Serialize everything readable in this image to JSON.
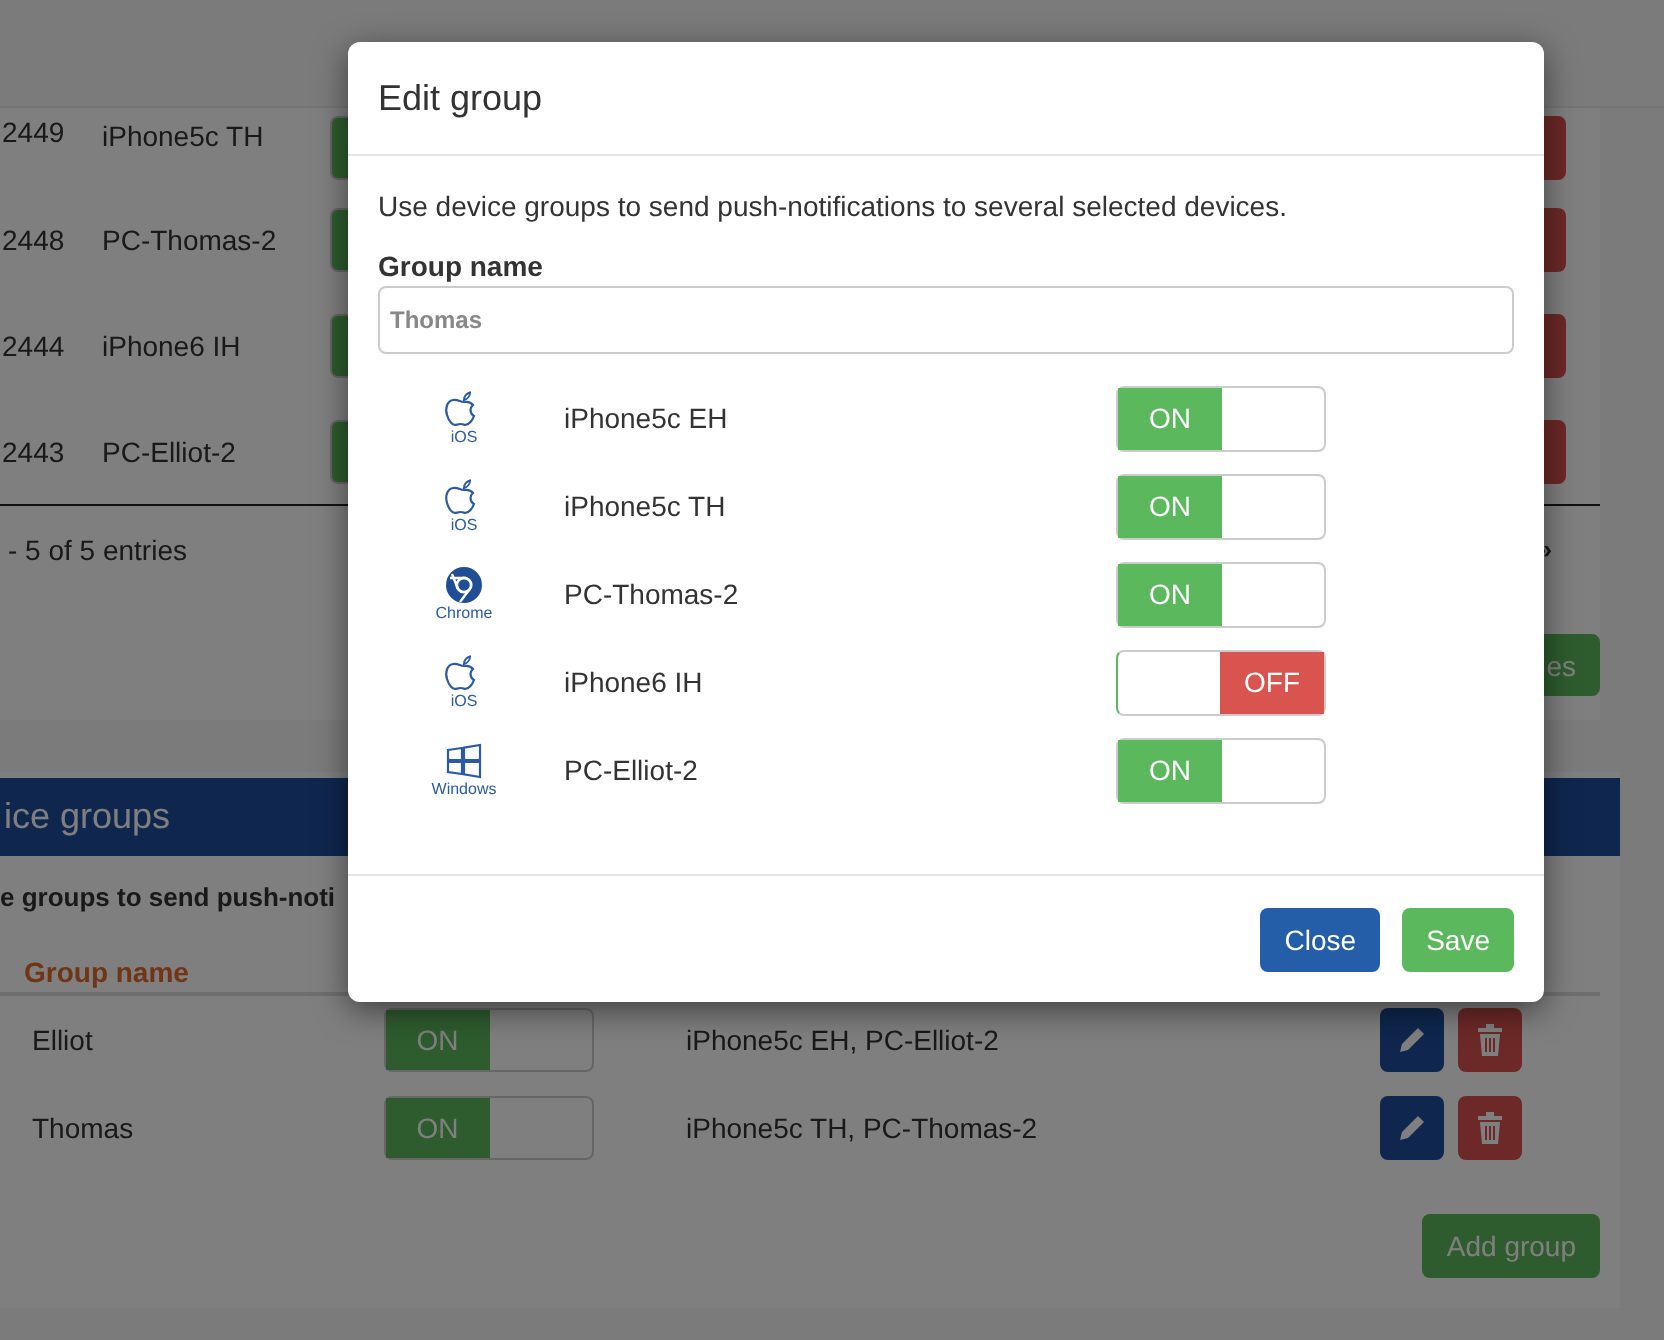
{
  "devices_table": {
    "rows": [
      {
        "id": "2449",
        "name": "iPhone5c TH",
        "on": true
      },
      {
        "id": "2448",
        "name": "PC-Thomas-2",
        "on": true
      },
      {
        "id": "2444",
        "name": "iPhone6 IH",
        "on": true
      },
      {
        "id": "2443",
        "name": "PC-Elliot-2",
        "on": true
      }
    ],
    "info": "- 5 of 5 entries",
    "next": "»",
    "save_button": "es"
  },
  "groups_panel": {
    "title": "ice groups",
    "intro": "e groups to send push-noti",
    "columns": [
      "Group name"
    ],
    "rows": [
      {
        "name": "Elliot",
        "on": true,
        "on_label": "ON",
        "devices": "iPhone5c EH, PC-Elliot-2"
      },
      {
        "name": "Thomas",
        "on": true,
        "on_label": "ON",
        "devices": "iPhone5c TH, PC-Thomas-2"
      }
    ],
    "add_button": "Add group"
  },
  "dialog": {
    "title": "Edit group",
    "intro": "Use device groups to send push-notifications to several selected devices.",
    "label": "Group name",
    "value": "Thomas",
    "devices": [
      {
        "kind": "ios",
        "platform": "iOS",
        "name": "iPhone5c EH",
        "on": true,
        "state_label": "ON"
      },
      {
        "kind": "ios",
        "platform": "iOS",
        "name": "iPhone5c TH",
        "on": true,
        "state_label": "ON"
      },
      {
        "kind": "chrome",
        "platform": "Chrome",
        "name": "PC-Thomas-2",
        "on": true,
        "state_label": "ON"
      },
      {
        "kind": "ios",
        "platform": "iOS",
        "name": "iPhone6 IH",
        "on": false,
        "state_label": "OFF"
      },
      {
        "kind": "windows",
        "platform": "Windows",
        "name": "PC-Elliot-2",
        "on": true,
        "state_label": "ON"
      }
    ],
    "buttons": [
      {
        "kind": "close",
        "label": "Close"
      },
      {
        "kind": "save",
        "label": "Save"
      }
    ]
  }
}
